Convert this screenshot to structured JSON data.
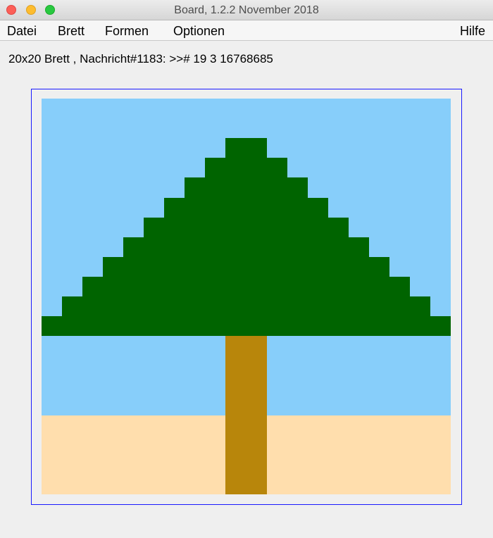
{
  "window": {
    "title": "Board, 1.2.2 November 2018"
  },
  "menubar": {
    "items": [
      {
        "label": "Datei"
      },
      {
        "label": "Brett"
      },
      {
        "label": "Formen"
      },
      {
        "label": "Optionen"
      }
    ],
    "help_label": "Hilfe"
  },
  "status": {
    "text": "20x20 Brett , Nachricht#1183: >># 19 3 16768685"
  },
  "board": {
    "columns": 20,
    "rows": 20,
    "colors": {
      "sky": "#87cefa",
      "sand": "#ffdead",
      "foliage": "#006400",
      "trunk": "#b8860b"
    },
    "pattern": [
      "SSSSSSSSSSSSSSSSSSSS",
      "SSSSSSSSSSSSSSSSSSSS",
      "SSSSSSSSSFFSSSSSSSSS",
      "SSSSSSSSFFFFSSSSSSSS",
      "SSSSSSSFFFFFFSSSSSSS",
      "SSSSSSFFFFFFFFSSSSSS",
      "SSSSSFFFFFFFFFFSSSSS",
      "SSSSFFFFFFFFFFFFSSSS",
      "SSSFFFFFFFFFFFFFFSSS",
      "SSFFFFFFFFFFFFFFFFSS",
      "SFFFFFFFFFFFFFFFFFFS",
      "FFFFFFFFFFFFFFFFFFFF",
      "SSSSSSSSSTTSSSSSSSSS",
      "SSSSSSSSSTTSSSSSSSSS",
      "SSSSSSSSSTTSSSSSSSSS",
      "SSSSSSSSSTTSSSSSSSSS",
      "DDDDDDDDDTTDDDDDDDDD",
      "DDDDDDDDDTTDDDDDDDDD",
      "DDDDDDDDDTTDDDDDDDDD",
      "DDDDDDDDDTTDDDDDDDDD"
    ],
    "legend": {
      "S": "sky",
      "D": "sand",
      "F": "foliage",
      "T": "trunk"
    }
  }
}
